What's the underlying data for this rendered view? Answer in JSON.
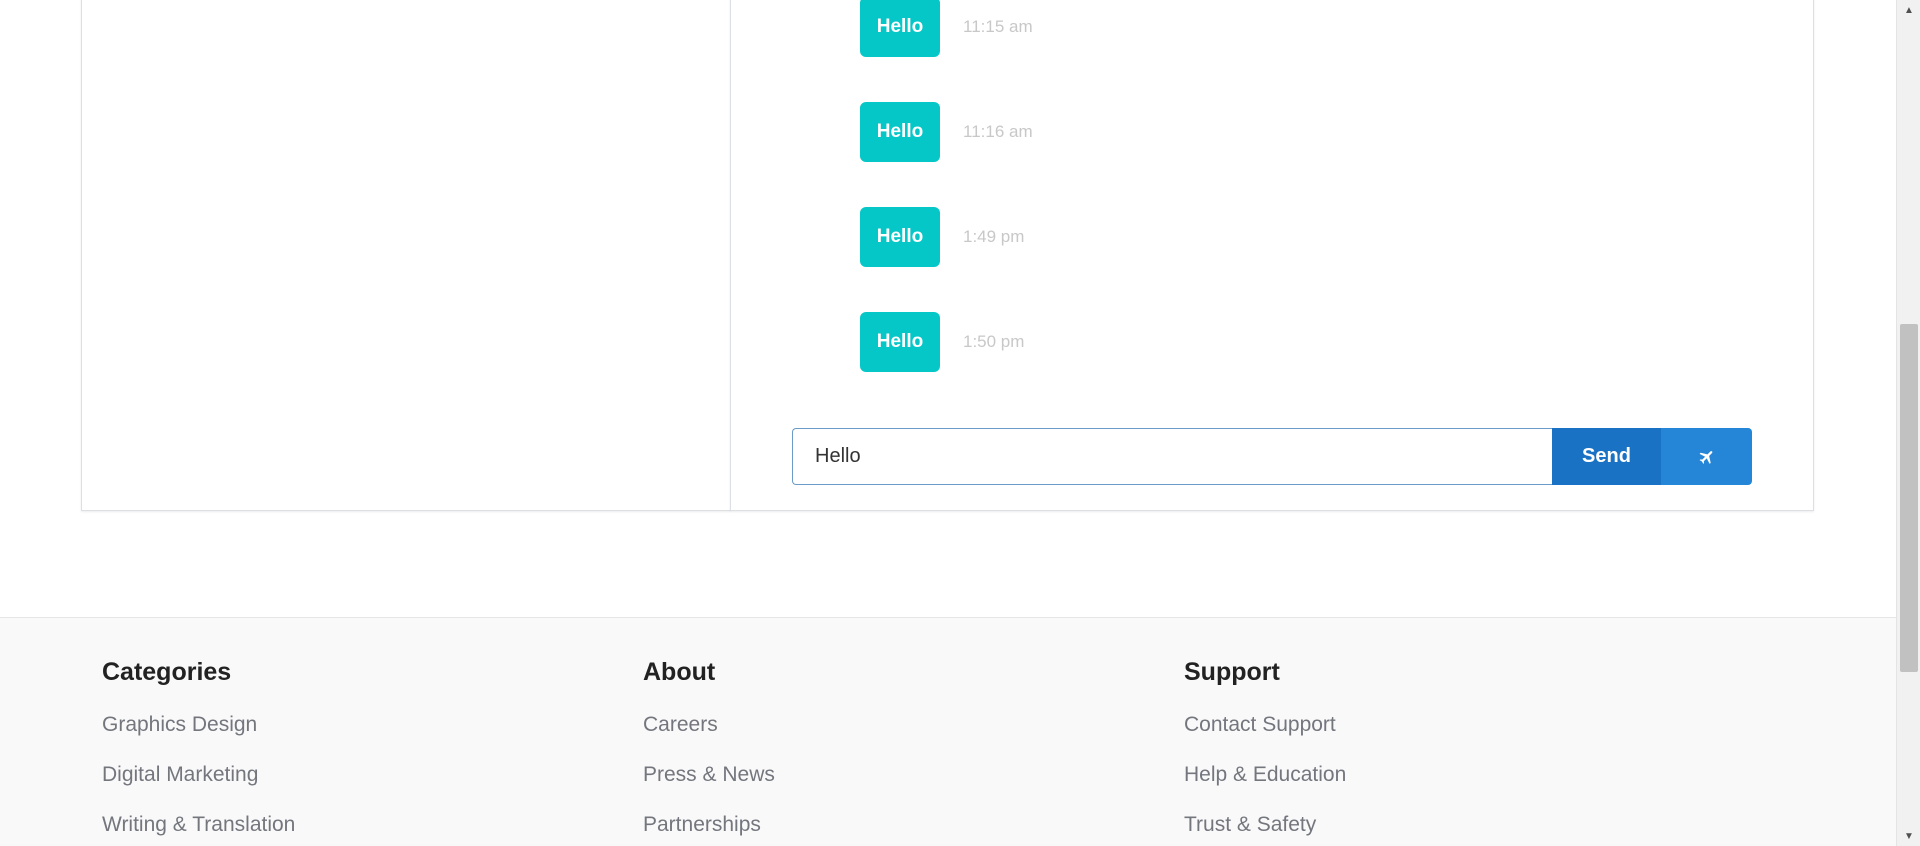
{
  "chat": {
    "messages": [
      {
        "text": "Hello",
        "time": "11:15 am"
      },
      {
        "text": "Hello",
        "time": "11:16 am"
      },
      {
        "text": "Hello",
        "time": "1:49 pm"
      },
      {
        "text": "Hello",
        "time": "1:50 pm"
      }
    ],
    "composer": {
      "value": "Hello",
      "send_label": "Send",
      "send_icon": "airplane-icon"
    },
    "colors": {
      "bubble": "#05c7c8",
      "send_button": "#1a72c4",
      "send_icon_button": "#2585d6"
    }
  },
  "footer": {
    "columns": [
      {
        "heading": "Categories",
        "links": [
          "Graphics Design",
          "Digital Marketing",
          "Writing & Translation"
        ]
      },
      {
        "heading": "About",
        "links": [
          "Careers",
          "Press & News",
          "Partnerships"
        ]
      },
      {
        "heading": "Support",
        "links": [
          "Contact Support",
          "Help & Education",
          "Trust & Safety"
        ]
      }
    ]
  }
}
